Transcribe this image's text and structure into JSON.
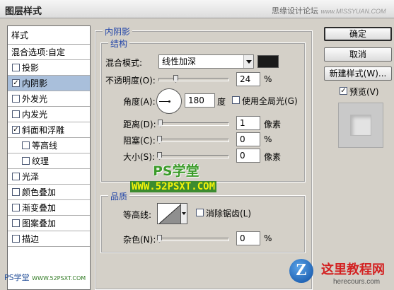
{
  "window": {
    "title": "图层样式",
    "credit": "思缘设计论坛",
    "credit_site": "www.MISSYUAN.COM"
  },
  "style_list": {
    "header": "样式",
    "blend_options": "混合选项:自定",
    "items": [
      {
        "label": "投影",
        "checked": false,
        "selected": false,
        "indent": false
      },
      {
        "label": "内阴影",
        "checked": true,
        "selected": true,
        "indent": false
      },
      {
        "label": "外发光",
        "checked": false,
        "selected": false,
        "indent": false
      },
      {
        "label": "内发光",
        "checked": false,
        "selected": false,
        "indent": false
      },
      {
        "label": "斜面和浮雕",
        "checked": true,
        "selected": false,
        "indent": false
      },
      {
        "label": "等高线",
        "checked": false,
        "selected": false,
        "indent": true
      },
      {
        "label": "纹理",
        "checked": false,
        "selected": false,
        "indent": true
      },
      {
        "label": "光泽",
        "checked": false,
        "selected": false,
        "indent": false
      },
      {
        "label": "颜色叠加",
        "checked": false,
        "selected": false,
        "indent": false
      },
      {
        "label": "渐变叠加",
        "checked": false,
        "selected": false,
        "indent": false
      },
      {
        "label": "图案叠加",
        "checked": false,
        "selected": false,
        "indent": false
      },
      {
        "label": "描边",
        "checked": false,
        "selected": false,
        "indent": false
      }
    ]
  },
  "inner_shadow": {
    "title": "内阴影",
    "structure": {
      "title": "结构",
      "blend_mode_label": "混合模式:",
      "blend_mode_value": "线性加深",
      "shadow_color": "#1a1a1a",
      "opacity_label": "不透明度(O):",
      "opacity_value": "24",
      "opacity_fraction": 0.24,
      "opacity_unit": "%",
      "angle_label": "角度(A):",
      "angle_value": "180",
      "angle_unit": "度",
      "global_light_label": "使用全局光(G)",
      "global_light_checked": false,
      "distance_label": "距离(D):",
      "distance_value": "1",
      "distance_unit": "像素",
      "choke_label": "阻塞(C):",
      "choke_value": "0",
      "choke_unit": "%",
      "size_label": "大小(S):",
      "size_value": "0",
      "size_unit": "像素"
    },
    "quality": {
      "title": "品质",
      "contour_label": "等高线:",
      "antialias_label": "消除锯齿(L)",
      "antialias_checked": false,
      "noise_label": "杂色(N):",
      "noise_value": "0",
      "noise_unit": "%"
    }
  },
  "buttons": {
    "ok": "确定",
    "cancel": "取消",
    "new_style": "新建样式(W)...",
    "preview_label": "预览(V)",
    "preview_checked": true
  },
  "watermarks": {
    "brand": "PS学堂",
    "url": "WWW.52PSXT.COM",
    "corner_brand": "PS学堂",
    "corner_url": "WWW.52PSXT.COM",
    "logo_letter": "Z",
    "logo_cn": "这里教程网",
    "logo_en": "herecours.com"
  }
}
